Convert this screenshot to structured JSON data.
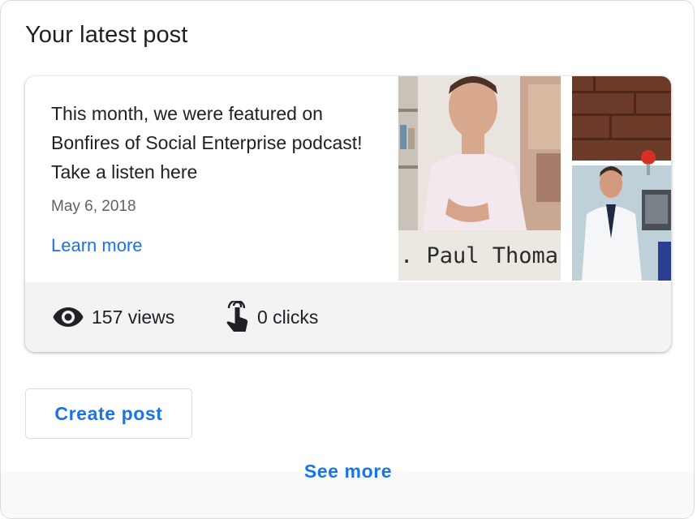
{
  "section": {
    "title": "Your latest post"
  },
  "post": {
    "text": "This month, we were featured on Bonfires of Social Enterprise podcast! Take a listen here",
    "date": "May 6, 2018",
    "learn_more_label": "Learn more",
    "image": {
      "caption_text": ". Paul Thomas"
    }
  },
  "stats": {
    "views_label": "157 views",
    "views_icon": "eye-icon",
    "clicks_label": "0 clicks",
    "clicks_icon": "touch-pointer-icon"
  },
  "actions": {
    "create_post_label": "Create post",
    "see_more_label": "See more"
  },
  "colors": {
    "accent": "#1a73e8",
    "text_primary": "#202124",
    "text_secondary": "#5f6368",
    "stats_background": "#f1f3f4"
  }
}
